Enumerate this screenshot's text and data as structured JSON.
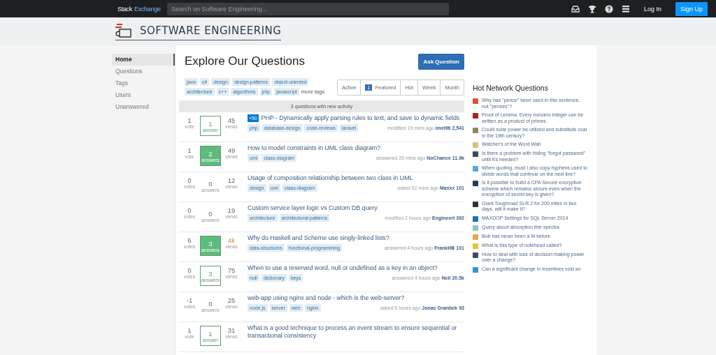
{
  "topbar": {
    "logo_a": "Stack",
    "logo_b": "Exchange",
    "search": {
      "placeholder": "Search on Software Engineering..."
    },
    "login": "Log In",
    "signup": "Sign Up"
  },
  "site": {
    "title": "SOFTWARE ENGINEERING"
  },
  "nav": [
    {
      "label": "Home",
      "selected": true
    },
    {
      "label": "Questions",
      "selected": false
    },
    {
      "label": "Tags",
      "selected": false
    },
    {
      "label": "Users",
      "selected": false
    },
    {
      "label": "Unanswered",
      "selected": false
    }
  ],
  "main": {
    "title": "Explore Our Questions",
    "ask": "Ask Question",
    "tags": [
      "java",
      "c#",
      "design",
      "design-patterns",
      "object-oriented",
      "architecture",
      "c++",
      "algorithms",
      "php",
      "javascript"
    ],
    "more_tags": "more tags",
    "filters": [
      {
        "label": "Active",
        "selected": false
      },
      {
        "label": "Featured",
        "count": "1",
        "selected": false
      },
      {
        "label": "Hot",
        "selected": false
      },
      {
        "label": "Week",
        "selected": false
      },
      {
        "label": "Month",
        "selected": false
      }
    ],
    "notice": "3 questions with new activity"
  },
  "questions": [
    {
      "votes": "1",
      "votes_label": "vote",
      "answers": "1",
      "answers_label": "answer",
      "answered": true,
      "accepted": false,
      "views": "45",
      "views_label": "views",
      "hot": false,
      "bounty": "+50",
      "title": "PHP - Dynamically apply parsing rules to text, and save to dynamic fields",
      "tags": [
        "php",
        "database-design",
        "code-reviews",
        "laravel"
      ],
      "action": "modified 19 mins ago",
      "user": "imel96",
      "rep": "2,541"
    },
    {
      "votes": "1",
      "votes_label": "vote",
      "answers": "2",
      "answers_label": "answers",
      "answered": true,
      "accepted": true,
      "views": "49",
      "views_label": "views",
      "hot": false,
      "title": "How to model constraints in UML class diagram?",
      "tags": [
        "uml",
        "class-diagram"
      ],
      "action": "answered 25 mins ago",
      "user": "NoChance",
      "rep": "11.9k"
    },
    {
      "votes": "0",
      "votes_label": "votes",
      "answers": "0",
      "answers_label": "answers",
      "answered": false,
      "accepted": false,
      "views": "12",
      "views_label": "views",
      "hot": false,
      "title": "Usage of composition relationship between two class in UML",
      "tags": [
        "design",
        "uml",
        "class-diagram"
      ],
      "action": "asked 52 mins ago",
      "user": "Maxxx",
      "rep": "101"
    },
    {
      "votes": "0",
      "votes_label": "votes",
      "answers": "0",
      "answers_label": "answers",
      "answered": false,
      "accepted": false,
      "views": "19",
      "views_label": "views",
      "hot": false,
      "title": "Custom service layer logic vs Custom DB query",
      "tags": [
        "architecture",
        "architectural-patterns"
      ],
      "action": "modified 2 hours ago",
      "user": "Engineert",
      "rep": "392"
    },
    {
      "votes": "6",
      "votes_label": "votes",
      "answers": "3",
      "answers_label": "answers",
      "answered": true,
      "accepted": true,
      "views": "4k",
      "views_label": "views",
      "hot": true,
      "title": "Why do Haskell and Scheme use singly-linked lists?",
      "tags": [
        "data-structures",
        "functional-programming"
      ],
      "action": "answered 4 hours ago",
      "user": "FrankHB",
      "rep": "101"
    },
    {
      "votes": "0",
      "votes_label": "votes",
      "answers": "3",
      "answers_label": "answers",
      "answered": true,
      "accepted": false,
      "views": "75",
      "views_label": "views",
      "hot": false,
      "title": "When to use a reserved word, null or undefined as a key in an object?",
      "tags": [
        "null",
        "dictionary",
        "keys"
      ],
      "action": "answered 4 hours ago",
      "user": "Neil",
      "rep": "20.5k"
    },
    {
      "votes": "-1",
      "votes_label": "votes",
      "answers": "0",
      "answers_label": "answers",
      "answered": false,
      "accepted": false,
      "views": "25",
      "views_label": "views",
      "hot": false,
      "title": "web-app using nginx and node - which is the web-server?",
      "tags": [
        "node.js",
        "server",
        "web",
        "nginx"
      ],
      "action": "asked 5 hours ago",
      "user": "Jonas Grønbek",
      "rep": "93"
    },
    {
      "votes": "1",
      "votes_label": "vote",
      "answers": "1",
      "answers_label": "answer",
      "answered": true,
      "accepted": false,
      "views": "31",
      "views_label": "views",
      "hot": false,
      "title": "What is a good technique to process an event stream to ensure sequential or transactional consistency"
    }
  ],
  "hot_network": {
    "title": "Hot Network Questions",
    "items": [
      {
        "text": "Why has \"pence\" been used in this sentence, not \"pences\"?",
        "color": "#e0533a"
      },
      {
        "text": "Proof of Lemma: Every nonzero integer can be written as a product of primes",
        "color": "#b01c1c"
      },
      {
        "text": "Could solar power be utilized and substitute coal in the 19th century?",
        "color": "#8c8a5a"
      },
      {
        "text": "Watcher's of the Word Wall",
        "color": "#d8c27a"
      },
      {
        "text": "Is there a problem with hiding \"forgot password\" until it's needed?",
        "color": "#3b4a5c"
      },
      {
        "text": "When quoting, must I also copy hyphens used to divide words that continue on the next line?",
        "color": "#5aa6d8"
      },
      {
        "text": "Is it possible to build a CPA Secure encryption scheme which remains secure even when the encryption of secret key is given?",
        "color": "#2a3a5a"
      },
      {
        "text": "Giant Toughroad SLR 2 for 200 miles in two days, will it make it?",
        "color": "#333333"
      },
      {
        "text": "MAXDOP Settings for SQL Server 2014",
        "color": "#1f6fb5"
      },
      {
        "text": "Query about absorption line spectra",
        "color": "#8fc6c8"
      },
      {
        "text": "Bob has never been a M before",
        "color": "#e0a84a"
      },
      {
        "text": "What is this type of notehead called?",
        "color": "#e8c43a"
      },
      {
        "text": "How to deal with loss of decision making power over a change?",
        "color": "#444c5c"
      },
      {
        "text": "Can a significant change in incentives void an",
        "color": "#3b8fd0"
      }
    ]
  }
}
